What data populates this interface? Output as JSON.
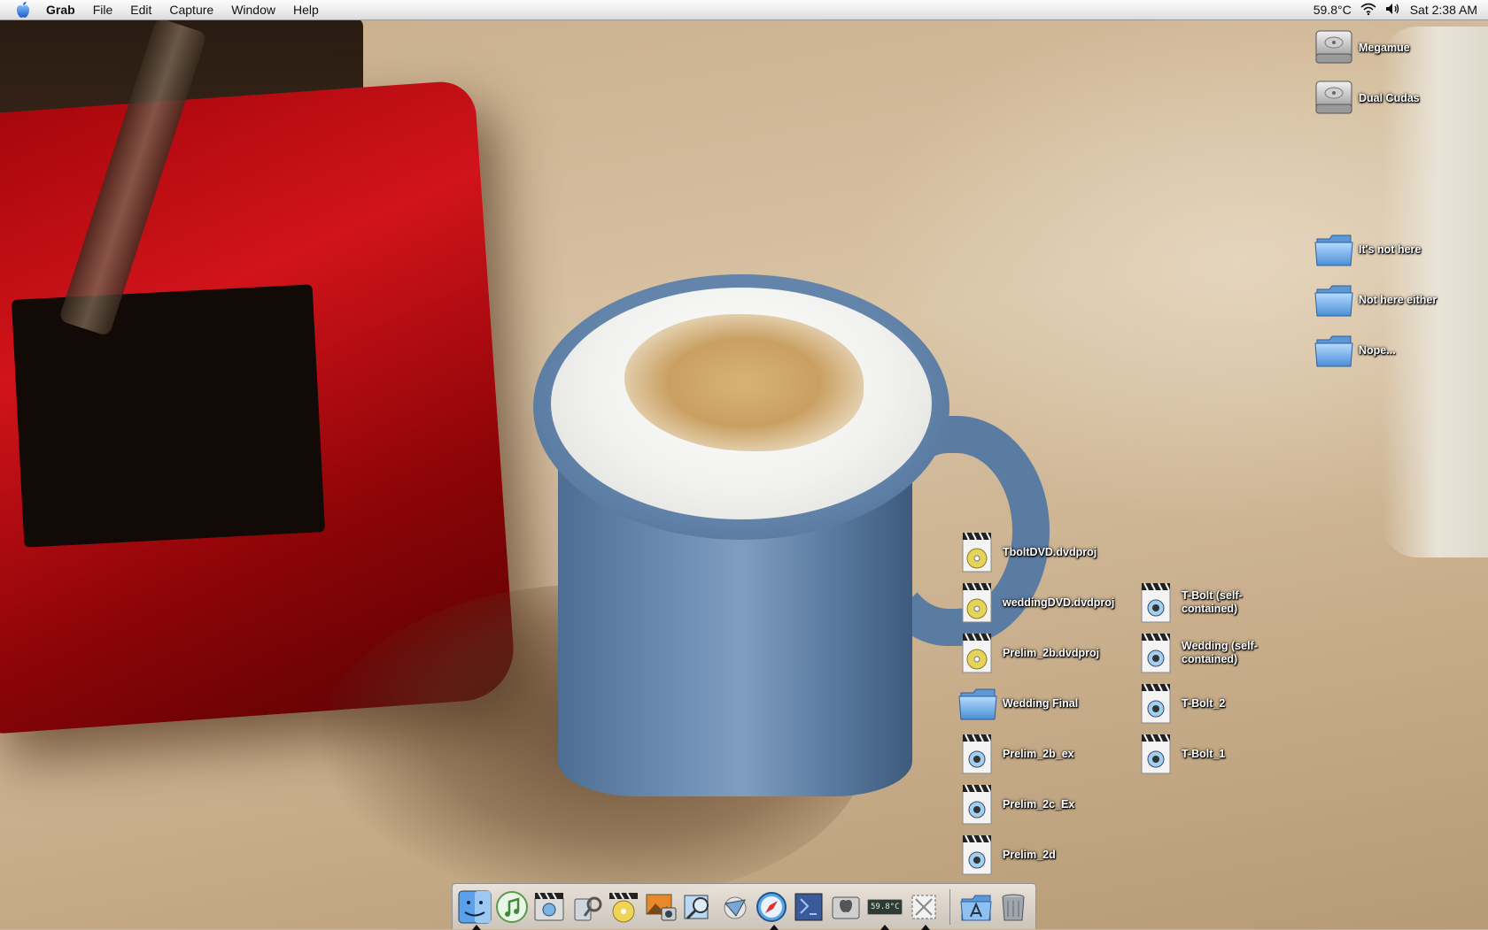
{
  "menubar": {
    "app_name": "Grab",
    "items": [
      "File",
      "Edit",
      "Capture",
      "Window",
      "Help"
    ],
    "temperature": "59.8°C",
    "clock": "Sat 2:38 AM"
  },
  "desktop": {
    "drives": [
      {
        "label": "Megamue"
      },
      {
        "label": "Dual Cudas"
      }
    ],
    "folders_right": [
      {
        "label": "It's not here"
      },
      {
        "label": "Not here either"
      },
      {
        "label": "Nope..."
      }
    ],
    "files_col1": [
      {
        "label": "TboltDVD.dvdproj",
        "kind": "dvdproj"
      },
      {
        "label": "weddingDVD.dvdproj",
        "kind": "dvdproj"
      },
      {
        "label": "Prelim_2b.dvdproj",
        "kind": "dvdproj"
      },
      {
        "label": "Wedding Final",
        "kind": "folder"
      },
      {
        "label": "Prelim_2b_ex",
        "kind": "movie"
      },
      {
        "label": "Prelim_2c_Ex",
        "kind": "movie"
      },
      {
        "label": "Prelim_2d",
        "kind": "movie"
      }
    ],
    "files_col2": [
      {
        "label": "T-Bolt (self-contained)",
        "kind": "movie"
      },
      {
        "label": "Wedding (self-contained)",
        "kind": "movie"
      },
      {
        "label": "T-Bolt_2",
        "kind": "movie"
      },
      {
        "label": "T-Bolt_1",
        "kind": "movie"
      }
    ]
  },
  "dock": {
    "temperature_widget": "59.8°C",
    "items": [
      "finder-icon",
      "itunes-icon",
      "imovie-icon",
      "system-profiler-icon",
      "idvd-icon",
      "iphoto-icon",
      "preview-icon",
      "mail-icon",
      "safari-icon",
      "terminal-icon",
      "system-preferences-icon",
      "temperature-monitor-icon",
      "grab-icon",
      "applications-folder-icon",
      "trash-icon"
    ]
  },
  "colors": {
    "menubar_bg": "#ececec",
    "folder_blue": "#6fa9e6",
    "mug_blue": "#6a8bb1",
    "machine_red": "#d1131b"
  }
}
